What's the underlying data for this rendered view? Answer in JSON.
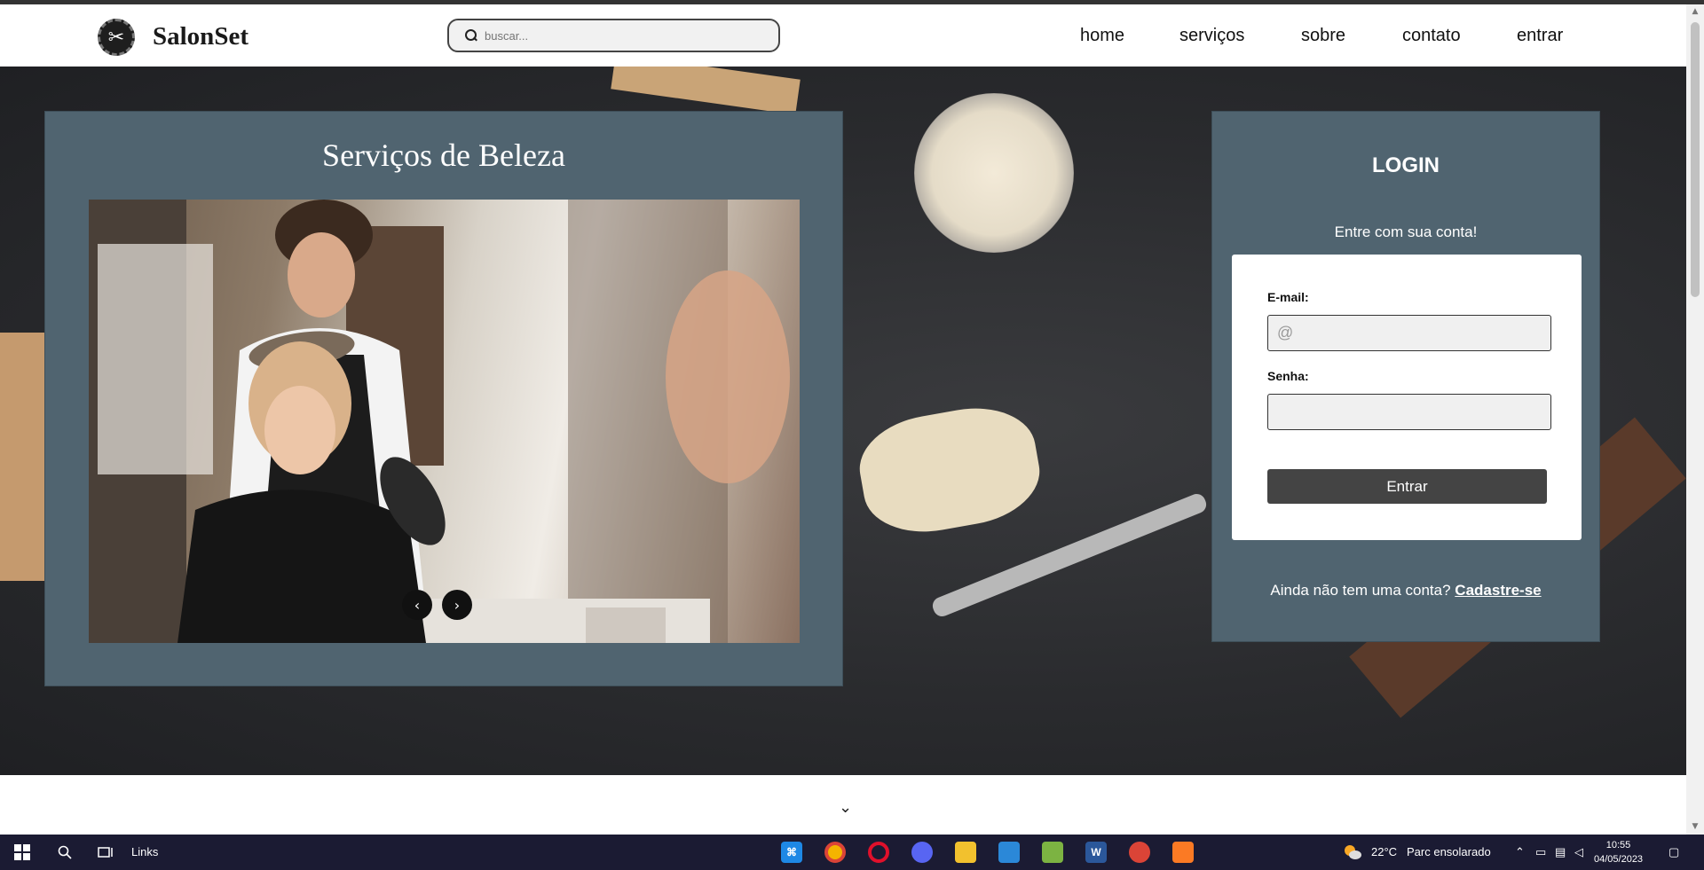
{
  "brand": {
    "name": "SalonSet",
    "logo_icon": "scissors-icon"
  },
  "search": {
    "placeholder": "buscar..."
  },
  "nav": {
    "items": [
      "home",
      "serviços",
      "sobre",
      "contato",
      "entrar"
    ]
  },
  "services": {
    "title": "Serviços de Beleza",
    "prev_icon": "chevron-left-icon",
    "next_icon": "chevron-right-icon"
  },
  "login": {
    "title": "LOGIN",
    "subtitle": "Entre com sua conta!",
    "email_label": "E-mail:",
    "email_placeholder": "@",
    "password_label": "Senha:",
    "submit_label": "Entrar",
    "signup_prompt": "Ainda não tem uma conta?",
    "signup_link": "Cadastre-se"
  },
  "scroll_icon": "chevron-down-icon",
  "taskbar": {
    "links_label": "Links",
    "weather_temp": "22°C",
    "weather_text": "Parc ensolarado",
    "time": "10:55",
    "date": "04/05/2023"
  },
  "colors": {
    "panel": "#506470",
    "button": "#444444",
    "taskbar": "#1b1b33"
  }
}
